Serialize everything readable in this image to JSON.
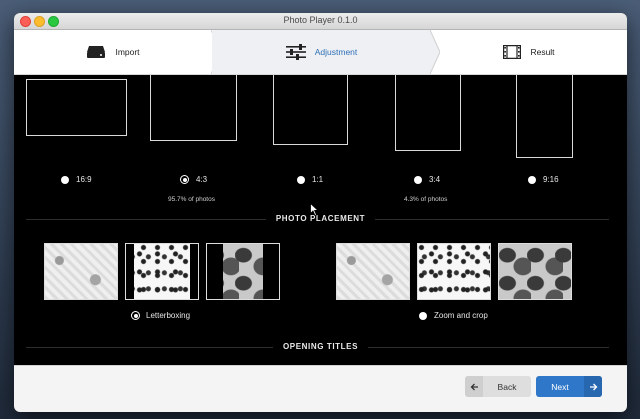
{
  "window": {
    "title": "Photo Player 0.1.0"
  },
  "steps": [
    {
      "label": "Import",
      "icon": "drive-icon",
      "active": false
    },
    {
      "label": "Adjustment",
      "icon": "sliders-icon",
      "active": true
    },
    {
      "label": "Result",
      "icon": "film-icon",
      "active": false
    }
  ],
  "aspect_ratios": [
    {
      "label": "16:9",
      "selected": false,
      "note": ""
    },
    {
      "label": "4:3",
      "selected": true,
      "note": "95.7% of photos"
    },
    {
      "label": "1:1",
      "selected": false,
      "note": ""
    },
    {
      "label": "3:4",
      "selected": false,
      "note": "4.3% of photos"
    },
    {
      "label": "9:16",
      "selected": false,
      "note": ""
    }
  ],
  "placement": {
    "title": "PHOTO PLACEMENT",
    "options": [
      {
        "label": "Letterboxing",
        "selected": true
      },
      {
        "label": "Zoom and crop",
        "selected": false
      }
    ]
  },
  "opening_titles": {
    "title": "OPENING TITLES"
  },
  "footer": {
    "back_label": "Back",
    "next_label": "Next"
  },
  "colors": {
    "accent": "#2f78c9",
    "active_step_text": "#2f6fb5"
  }
}
